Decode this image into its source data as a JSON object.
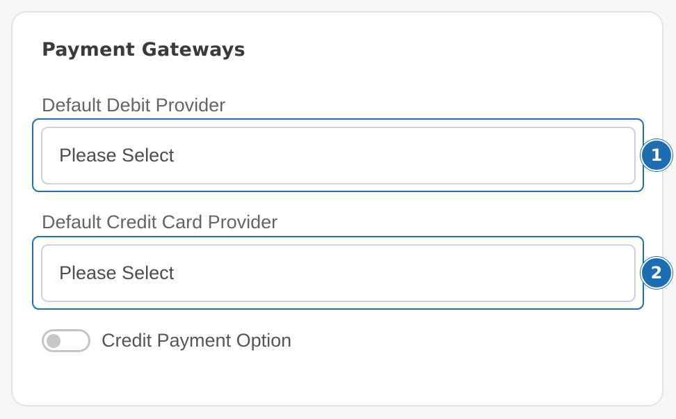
{
  "panel": {
    "title": "Payment Gateways"
  },
  "fields": {
    "debit": {
      "label": "Default Debit Provider",
      "value": "Please Select",
      "badge": "1"
    },
    "credit": {
      "label": "Default Credit Card Provider",
      "value": "Please Select",
      "badge": "2"
    }
  },
  "toggle": {
    "label": "Credit Payment Option",
    "checked": false
  },
  "colors": {
    "accent": "#1d6db5",
    "border": "#cfcfd4",
    "text": "#4c4c4c"
  }
}
